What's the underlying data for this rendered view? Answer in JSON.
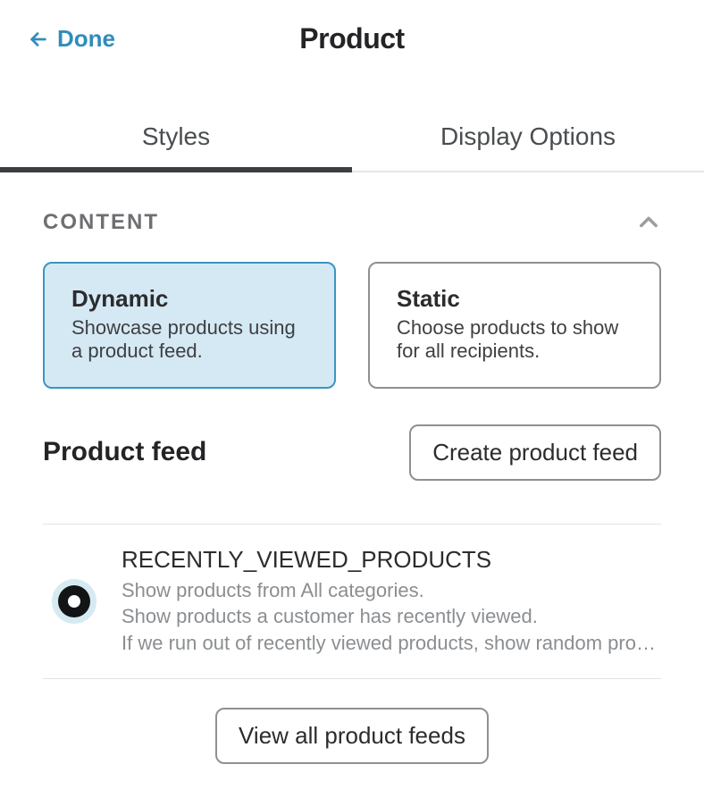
{
  "header": {
    "back_label": "Done",
    "title": "Product"
  },
  "tabs": [
    {
      "label": "Styles",
      "active": true
    },
    {
      "label": "Display Options",
      "active": false
    }
  ],
  "section": {
    "label": "CONTENT"
  },
  "cards": {
    "dynamic": {
      "title": "Dynamic",
      "desc": "Showcase products using a product feed."
    },
    "static": {
      "title": "Static",
      "desc": "Choose products to show for all recipients."
    }
  },
  "feed_section": {
    "title": "Product feed",
    "create_label": "Create product feed"
  },
  "feed_item": {
    "name": "RECENTLY_VIEWED_PRODUCTS",
    "line1": "Show products from All categories.",
    "line2": "Show products a customer has recently viewed.",
    "line3": "If we run out of recently viewed products, show random products."
  },
  "view_all_label": "View all product feeds"
}
